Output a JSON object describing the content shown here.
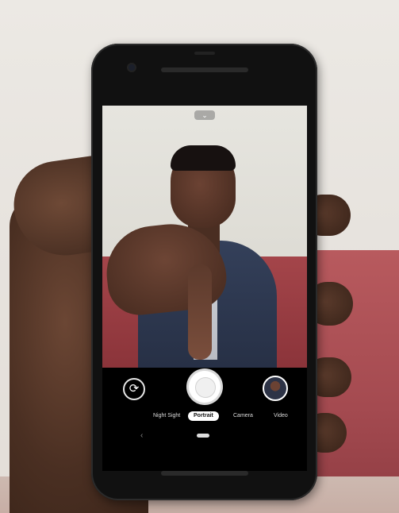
{
  "camera_app": {
    "modes": [
      {
        "label": "Night Sight",
        "selected": false
      },
      {
        "label": "Portrait",
        "selected": true
      },
      {
        "label": "Camera",
        "selected": false
      },
      {
        "label": "Video",
        "selected": false
      }
    ],
    "icons": {
      "collapse": "chevron-down-icon",
      "switch_camera": "switch-camera-icon",
      "shutter": "shutter-icon",
      "gallery": "gallery-thumbnail",
      "nav_back": "back-icon",
      "nav_home": "home-pill-icon"
    },
    "glyphs": {
      "chevron": "⌄",
      "switch_camera": "⟳",
      "back": "‹"
    }
  }
}
